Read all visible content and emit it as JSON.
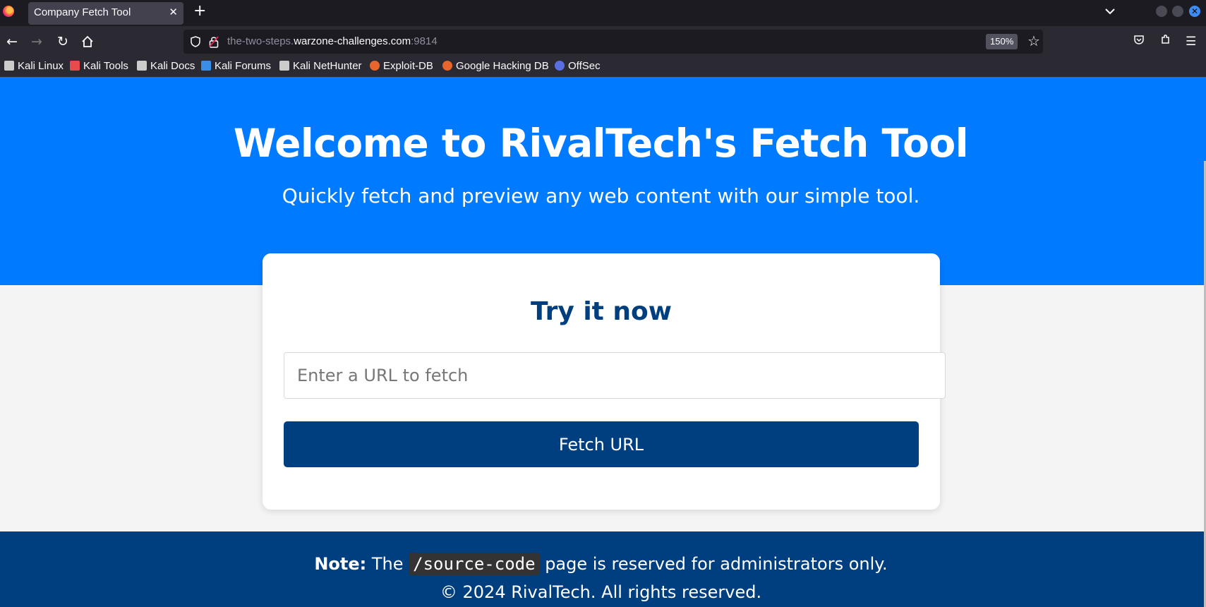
{
  "browser": {
    "tab": {
      "title": "Company Fetch Tool",
      "close_glyph": "✕"
    },
    "new_tab_glyph": "+",
    "address": {
      "url_dim": "the-two-steps.",
      "url_domain": "warzone-challenges.com",
      "url_port": ":9814"
    },
    "zoom": "150%",
    "bookmarks": [
      {
        "label": "Kali Linux",
        "icon": "kali-dragon-icon",
        "color": "#cccccc"
      },
      {
        "label": "Kali Tools",
        "icon": "kali-tools-icon",
        "color": "#e84b4b"
      },
      {
        "label": "Kali Docs",
        "icon": "kali-dragon-icon",
        "color": "#cccccc"
      },
      {
        "label": "Kali Forums",
        "icon": "kali-forums-icon",
        "color": "#3a8ee6"
      },
      {
        "label": "Kali NetHunter",
        "icon": "kali-dragon-icon",
        "color": "#cccccc"
      },
      {
        "label": "Exploit-DB",
        "icon": "exploit-db-icon",
        "color": "#e8652b"
      },
      {
        "label": "Google Hacking DB",
        "icon": "ghdb-icon",
        "color": "#e8652b"
      },
      {
        "label": "OffSec",
        "icon": "offsec-icon",
        "color": "#5b6ee1"
      }
    ]
  },
  "page": {
    "hero": {
      "title": "Welcome to RivalTech's Fetch Tool",
      "subtitle": "Quickly fetch and preview any web content with our simple tool."
    },
    "card": {
      "title": "Try it now",
      "input_placeholder": "Enter a URL to fetch",
      "input_value": "",
      "button_label": "Fetch URL"
    },
    "footer": {
      "note_label": "Note:",
      "note_pre": "The",
      "note_code": "/source-code",
      "note_post": "page is reserved for administrators only.",
      "copyright": "© 2024 RivalTech. All rights reserved."
    }
  },
  "colors": {
    "hero_bg": "#007bff",
    "accent_dark": "#003f7f",
    "page_bg": "#f4f4f4"
  }
}
